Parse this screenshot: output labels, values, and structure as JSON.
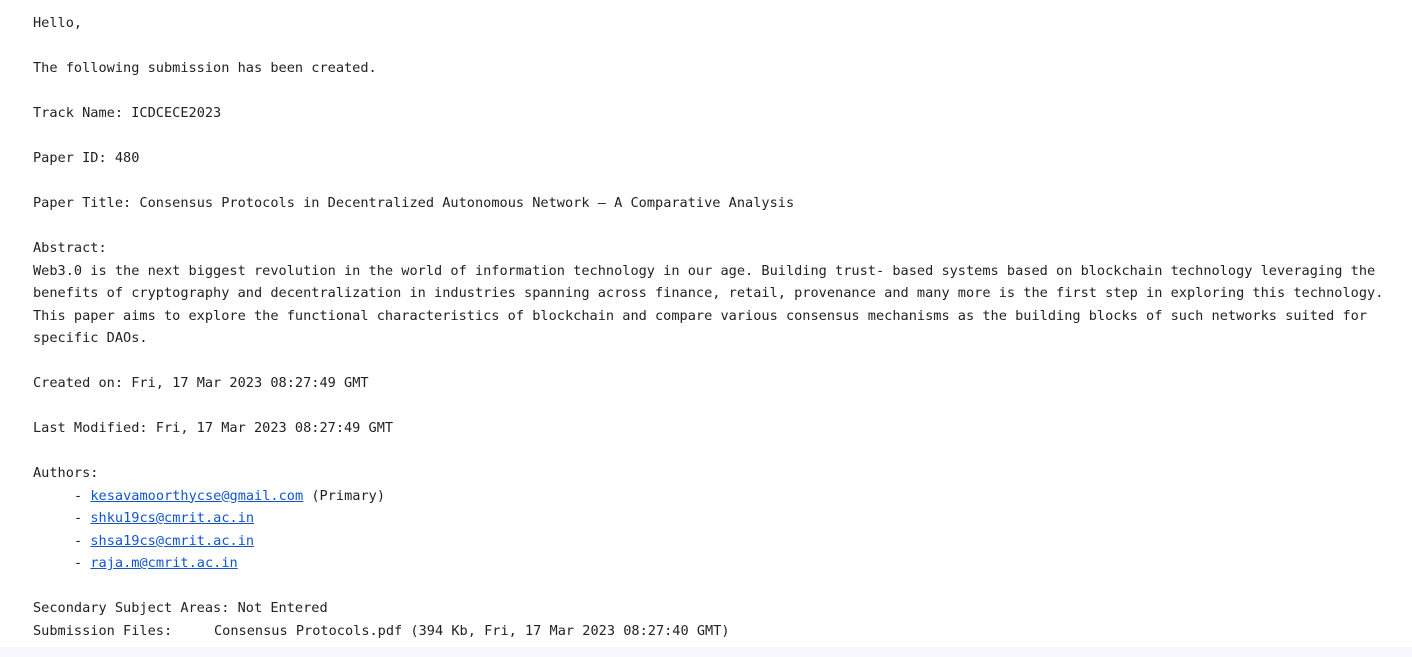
{
  "greeting": "Hello,",
  "intro": "The following submission has been created.",
  "track": {
    "label": "Track Name:",
    "value": "ICDCECE2023"
  },
  "paper_id": {
    "label": "Paper ID:",
    "value": "480"
  },
  "paper_title": {
    "label": "Paper Title:",
    "value": "Consensus Protocols in Decentralized Autonomous Network – A Comparative Analysis"
  },
  "abstract": {
    "label": "Abstract:",
    "text": "Web3.0 is the next biggest revolution in the world of information technology in our age. Building trust- based systems based on blockchain technology leveraging the benefits of cryptography and decentralization in industries spanning across finance, retail, provenance and many more is the first step in exploring this technology. This paper aims to explore the functional characteristics of blockchain and compare various consensus mechanisms as the building blocks of such networks suited for specific DAOs."
  },
  "created_on": {
    "label": "Created on:",
    "value": "Fri, 17 Mar 2023 08:27:49 GMT"
  },
  "last_modified": {
    "label": "Last Modified:",
    "value": "Fri, 17 Mar 2023 08:27:49 GMT"
  },
  "authors": {
    "label": "Authors:",
    "bullet": "- ",
    "list": [
      {
        "email": "kesavamoorthycse@gmail.com",
        "note": " (Primary)"
      },
      {
        "email": "shku19cs@cmrit.ac.in",
        "note": ""
      },
      {
        "email": "shsa19cs@cmrit.ac.in",
        "note": ""
      },
      {
        "email": "raja.m@cmrit.ac.in",
        "note": ""
      }
    ]
  },
  "secondary_subject_areas": {
    "label": "Secondary Subject Areas:",
    "value": "Not Entered"
  },
  "submission_files": {
    "label": "Submission Files:",
    "value": "Consensus Protocols.pdf (394 Kb, Fri, 17 Mar 2023 08:27:40 GMT)"
  },
  "colors": {
    "text": "#222222",
    "link": "#1155cc",
    "background": "#ffffff"
  }
}
